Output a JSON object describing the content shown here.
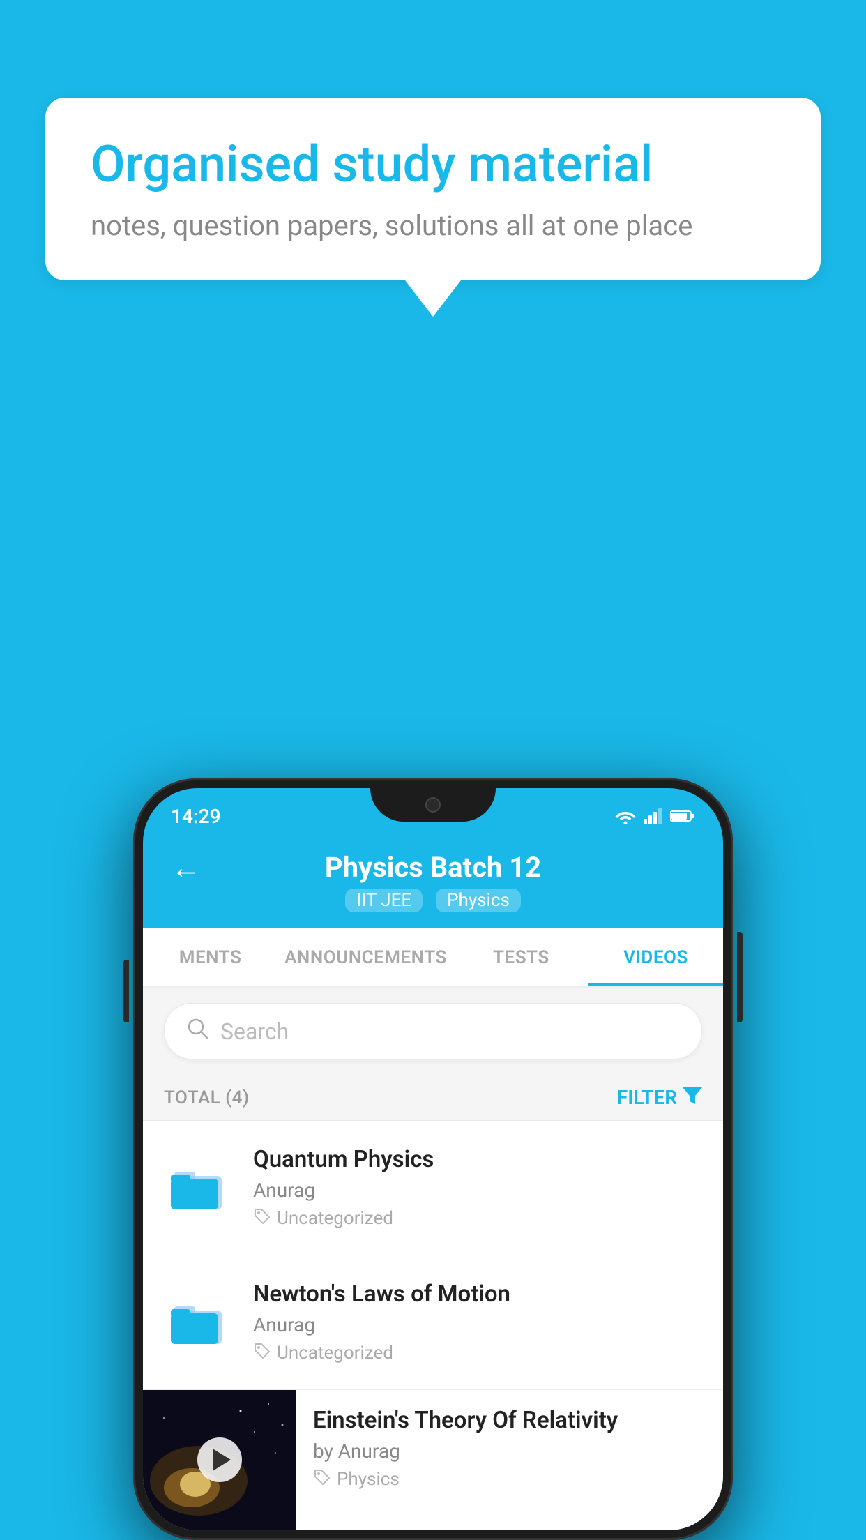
{
  "background_color": "#1ab8e8",
  "speech_bubble": {
    "title": "Organised study material",
    "subtitle": "notes, question papers, solutions all at one place"
  },
  "phone": {
    "status_bar": {
      "time": "14:29"
    },
    "header": {
      "title": "Physics Batch 12",
      "tags": [
        "IIT JEE",
        "Physics"
      ],
      "back_label": "←"
    },
    "tabs": [
      {
        "label": "MENTS",
        "active": false
      },
      {
        "label": "ANNOUNCEMENTS",
        "active": false
      },
      {
        "label": "TESTS",
        "active": false
      },
      {
        "label": "VIDEOS",
        "active": true
      }
    ],
    "search": {
      "placeholder": "Search"
    },
    "filter_bar": {
      "total_label": "TOTAL (4)",
      "filter_label": "FILTER"
    },
    "list_items": [
      {
        "id": "quantum",
        "title": "Quantum Physics",
        "author": "Anurag",
        "category": "Uncategorized",
        "has_thumb": false
      },
      {
        "id": "newton",
        "title": "Newton's Laws of Motion",
        "author": "Anurag",
        "category": "Uncategorized",
        "has_thumb": false
      },
      {
        "id": "einstein",
        "title": "Einstein's Theory Of Relativity",
        "author": "by Anurag",
        "category": "Physics",
        "has_thumb": true
      }
    ]
  }
}
